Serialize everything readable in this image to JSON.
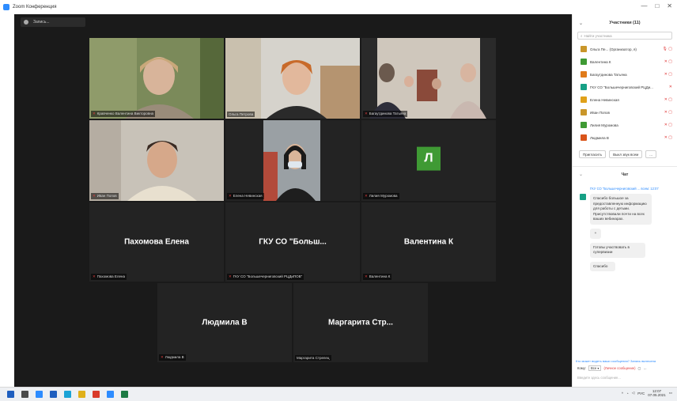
{
  "window": {
    "title": "Zoom Конференция",
    "controls": [
      "—",
      "□",
      "✕"
    ]
  },
  "meeting": {
    "view_chip": "Запись..."
  },
  "tiles": [
    {
      "id": "t1",
      "label": "Кравченко Валентина Викторовна",
      "muted": true
    },
    {
      "id": "t2",
      "label": "Ольга Петрова",
      "muted": false,
      "active": true
    },
    {
      "id": "t3",
      "label": "Багаутдинова Татьяна",
      "muted": true
    },
    {
      "id": "t4",
      "label": "Иван Попов",
      "muted": true
    },
    {
      "id": "t5",
      "label": "Елена Невинская",
      "muted": true
    },
    {
      "id": "t6",
      "label": "Лилия Муромова",
      "muted": true,
      "avatar": "Л"
    },
    {
      "id": "t7",
      "label": "Пахомова Елена",
      "big": "Пахомова Елена",
      "muted": true
    },
    {
      "id": "t8",
      "label": "ГКУ СО \"Большечерниговский РЦДиПОВ\"",
      "big": "ГКУ СО \"Больш...",
      "muted": true
    },
    {
      "id": "t9",
      "label": "Валентина К",
      "big": "Валентина К",
      "muted": true
    },
    {
      "id": "t10",
      "label": "Людмила В",
      "big": "Людмила В",
      "muted": true
    },
    {
      "id": "t11",
      "label": "Маргарита Стрелец",
      "big": "Маргарита Стр...",
      "muted": false
    }
  ],
  "panel": {
    "participants_title": "Участники (11)",
    "search_placeholder": "Найти участника",
    "participants": [
      {
        "name": "Ольга Пе... (Организатор, я)",
        "color": "#c9962a",
        "icons": "🎙 ▢"
      },
      {
        "name": "Валентина К",
        "color": "#3f9a34",
        "icons": "✕ ▢"
      },
      {
        "name": "Багаутдинова Татьяна",
        "color": "#e07b1a",
        "icons": "✕ ▢"
      },
      {
        "name": "ГКУ СО \"Большечерниговский РЦДи...",
        "color": "#16a085",
        "icons": "✕"
      },
      {
        "name": "Елена Невинская",
        "color": "#e0a11a",
        "icons": "✕ ▢"
      },
      {
        "name": "Иван Попов",
        "color": "#c9962a",
        "icons": "✕ ▢"
      },
      {
        "name": "Лилия Муромова",
        "color": "#3f9a34",
        "icons": "✕ ▢"
      },
      {
        "name": "Людмила В",
        "color": "#d9541a",
        "icons": "✕ ▢"
      }
    ],
    "invite_label": "Пригласить",
    "mute_all_label": "Выкл звук всем",
    "more_label": "...",
    "chat_title": "Чат",
    "chat_sender": "ГКУ СО \"Большечерниговский ... всем: 12:07",
    "messages": [
      "Спасибо большое за предоставленную информацию для работы с детьми. Присутствовали почти на всех ваших вебинарах.",
      "+",
      "Готовы участвовать в супервизии",
      "Спасибо"
    ],
    "chat_notice": "Кто может видеть ваши сообщения? Запись включена",
    "to_label": "Кому:",
    "to_value": "Все ▾",
    "private_label": "(Личное сообщение)",
    "input_placeholder": "Введите здесь сообщение..."
  },
  "taskbar": {
    "icons": [
      {
        "name": "start-icon",
        "color": "#1f5fbf"
      },
      {
        "name": "search-icon",
        "color": "#4a4a4a"
      },
      {
        "name": "taskview-icon",
        "color": "#2d8cff"
      },
      {
        "name": "calculator-icon",
        "color": "#1f5fbf"
      },
      {
        "name": "edge-icon",
        "color": "#1aa3d6"
      },
      {
        "name": "explorer-icon",
        "color": "#e0b01a"
      },
      {
        "name": "yandex-icon",
        "color": "#d93a2a"
      },
      {
        "name": "zoom-icon",
        "color": "#2d8cff"
      },
      {
        "name": "excel-icon",
        "color": "#1d7a44"
      }
    ],
    "lang": "РУС",
    "time": "12:07",
    "date": "07.05.2021"
  }
}
